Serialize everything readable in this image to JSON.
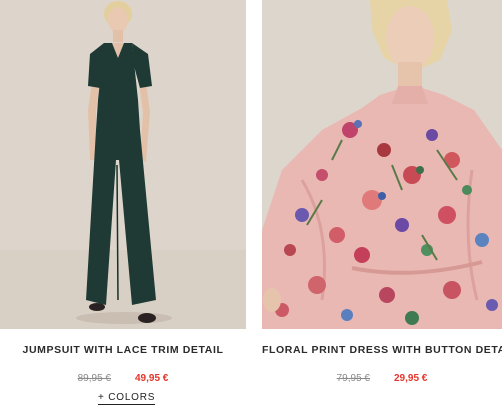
{
  "products": [
    {
      "title": "JUMPSUIT WITH LACE TRIM DETAIL",
      "old_price": "89,95 €",
      "sale_price": "49,95 €",
      "image_icon": "jumpsuit-model-photo"
    },
    {
      "title": "FLORAL PRINT DRESS WITH BUTTON DETAILS",
      "old_price": "79,95 €",
      "sale_price": "29,95 €",
      "image_icon": "floral-dress-model-photo"
    }
  ],
  "colors_link": "+ COLORS",
  "colors": {
    "sale_red": "#e5352b",
    "old_price_gray": "#8a8a8a",
    "jumpsuit_green": "#1f3a34",
    "dress_pink": "#e9b8b3",
    "studio_beige": "#ddd6cc"
  }
}
